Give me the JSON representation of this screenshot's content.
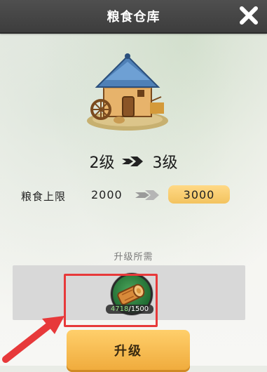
{
  "window": {
    "title": "粮食仓库",
    "close_icon": "close-x-icon"
  },
  "building": {
    "icon": "granary-building-icon"
  },
  "level_change": {
    "from": "2级",
    "to": "3级",
    "arrow_icon": "double-chevron-right-icon"
  },
  "stat": {
    "label": "粮食上限",
    "current": "2000",
    "next": "3000",
    "arrow_icon": "double-chevron-right-gray-icon",
    "next_bg": "#f3c35f"
  },
  "requirements": {
    "title": "升级所需",
    "items": [
      {
        "icon": "wood-log-icon",
        "have": "4718",
        "need": "1500"
      }
    ]
  },
  "annotation": {
    "highlight_color": "#e7393a",
    "pointer_icon": "red-arrow-pointer-icon"
  },
  "actions": {
    "upgrade_label": "升级"
  }
}
